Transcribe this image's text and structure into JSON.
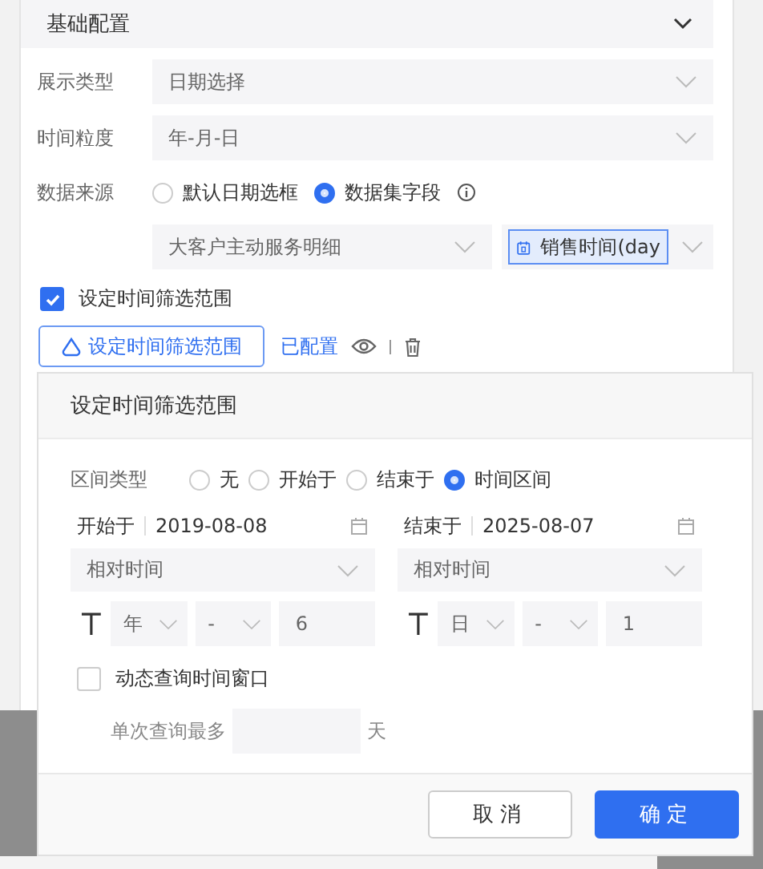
{
  "section": {
    "title": "基础配置",
    "expanded": true
  },
  "fields": [
    {
      "label": "展示类型",
      "value": "日期选择"
    },
    {
      "label": "时间粒度",
      "value": "年-月-日"
    }
  ],
  "data_source": {
    "label": "数据来源",
    "options": [
      {
        "label": "默认日期选框",
        "selected": false
      },
      {
        "label": "数据集字段",
        "selected": true
      }
    ],
    "dataset": "大客户主动服务明细",
    "field": "销售时间(day"
  },
  "range_check": {
    "label": "设定时间筛选范围",
    "checked": true
  },
  "range_button": "设定时间筛选范围",
  "configured_link": "已配置",
  "dialog": {
    "title": "设定时间筛选范围",
    "interval_label": "区间类型",
    "interval_options": [
      {
        "label": "无",
        "selected": false
      },
      {
        "label": "开始于",
        "selected": false
      },
      {
        "label": "结束于",
        "selected": false
      },
      {
        "label": "时间区间",
        "selected": true
      }
    ],
    "ends": [
      {
        "label": "开始于",
        "date": "2019-08-08",
        "mode": "相对时间",
        "unit": "年",
        "sign": "-",
        "amount": "6"
      },
      {
        "label": "结束于",
        "date": "2025-08-07",
        "mode": "相对时间",
        "unit": "日",
        "sign": "-",
        "amount": "1"
      }
    ],
    "dynamic": {
      "label": "动态查询时间窗口",
      "checked": false
    },
    "max_label": "单次查询最多",
    "max_unit": "天",
    "buttons": [
      {
        "label": "取消",
        "kind": "secondary"
      },
      {
        "label": "确定",
        "kind": "primary"
      }
    ]
  }
}
